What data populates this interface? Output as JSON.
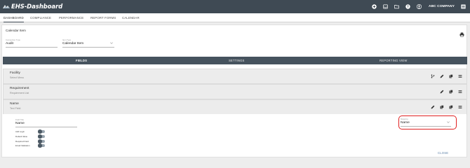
{
  "app": {
    "logo_text": "EHS-Dashboard",
    "company": "ABC COMPANY",
    "top_icons": [
      "add-circle-icon",
      "inbox-icon",
      "folder-icon",
      "help-icon",
      "account-icon",
      "menu-icon"
    ]
  },
  "nav": {
    "tabs": [
      {
        "label": "DASHBOARD",
        "active": true
      },
      {
        "label": "COMPLIANCE",
        "active": false
      },
      {
        "label": "PERFORMANCE",
        "active": false
      },
      {
        "label": "REPORT FORMS",
        "active": false
      },
      {
        "label": "CALENDAR",
        "active": false
      }
    ]
  },
  "panel": {
    "title": "Calendar Item",
    "form_type": {
      "label": "Connection Type",
      "value": "Audit"
    },
    "item_type": {
      "label": "Item Type",
      "value": "Calendar Item"
    }
  },
  "section_tabs": [
    {
      "label": "FIELDS",
      "active": true
    },
    {
      "label": "SETTINGS",
      "active": false
    },
    {
      "label": "REPORTING VIEW",
      "active": false
    }
  ],
  "field_rows": [
    {
      "title": "Facility",
      "subtitle": "Select Menu",
      "actions": [
        "branch-icon",
        "edit-icon",
        "copy-icon",
        "drag-handle-icon"
      ]
    },
    {
      "title": "Requirement",
      "subtitle": "Requirement List",
      "actions": [
        "edit-icon",
        "copy-icon",
        "drag-handle-icon"
      ]
    },
    {
      "title": "Name",
      "subtitle": "Text Field",
      "actions": [
        "edit-icon",
        "copy-icon",
        "copy-icon",
        "drag-handle-icon"
      ]
    }
  ],
  "expanded": {
    "field_label": {
      "label": "Field Title",
      "value": "Name"
    },
    "options": [
      {
        "label": "Add Login",
        "on": false
      },
      {
        "label": "Default Value",
        "on": false
      },
      {
        "label": "Required Field",
        "on": false
      },
      {
        "label": "Email Validation",
        "on": false
      }
    ],
    "mapping": {
      "label": "Mapping",
      "value": "Name"
    },
    "close_label": "CLOSE"
  },
  "colors": {
    "topbar": "#3f4a54",
    "tabbar": "#46535e",
    "highlight": "#e02020",
    "link": "#5b7fa6"
  }
}
